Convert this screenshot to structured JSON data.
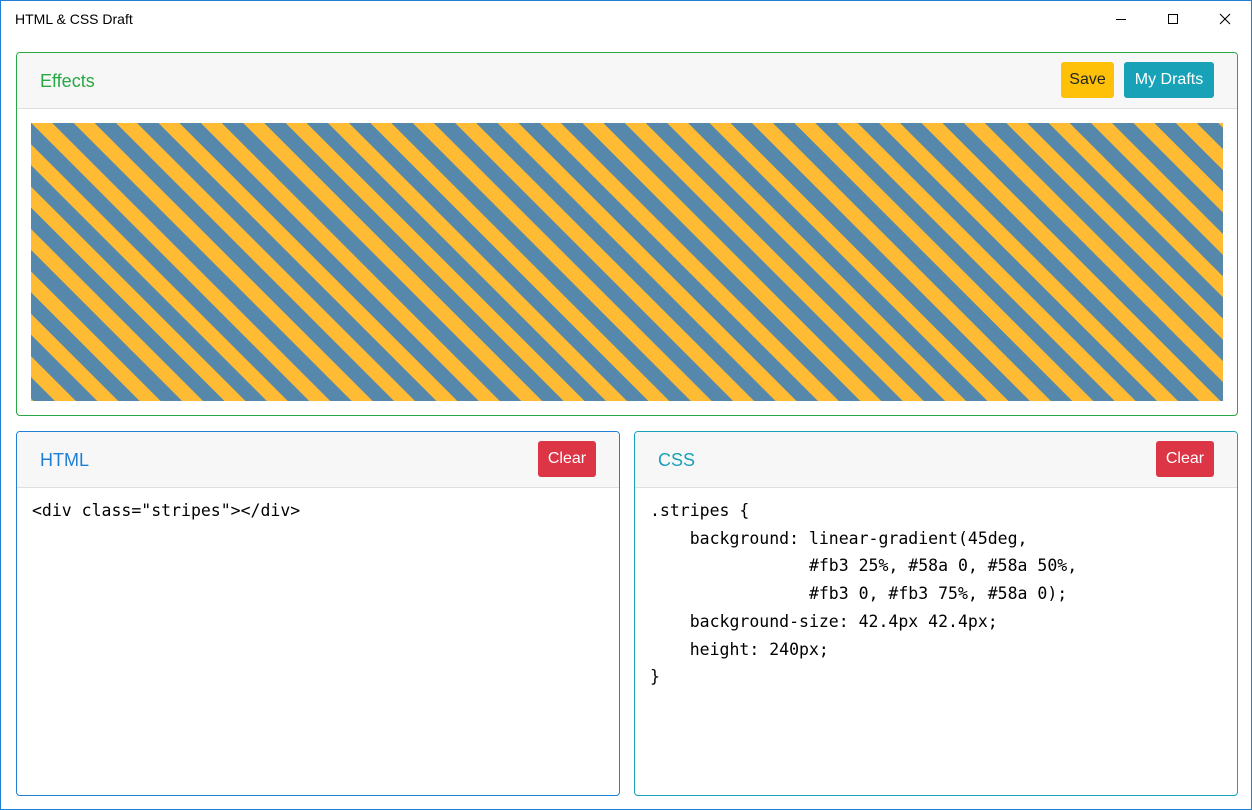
{
  "window": {
    "title": "HTML & CSS Draft",
    "controls": [
      "minimize-icon",
      "maximize-icon",
      "close-icon"
    ]
  },
  "effects": {
    "title": "Effects",
    "save_label": "Save",
    "drafts_label": "My Drafts",
    "stripe_colors": [
      "#ffbb33",
      "#5588aa"
    ]
  },
  "html_panel": {
    "title": "HTML",
    "clear_label": "Clear",
    "code": "<div class=\"stripes\"></div>"
  },
  "css_panel": {
    "title": "CSS",
    "clear_label": "Clear",
    "code": ".stripes {\n    background: linear-gradient(45deg,\n                #fb3 25%, #58a 0, #58a 50%,\n                #fb3 0, #fb3 75%, #58a 0);\n    background-size: 42.4px 42.4px;\n    height: 240px;\n}"
  },
  "colors": {
    "effects_accent": "#28a745",
    "html_accent": "#1f7fd4",
    "css_accent": "#17a2b8",
    "save": "#ffc107",
    "drafts": "#17a2b8",
    "clear": "#dc3545"
  }
}
